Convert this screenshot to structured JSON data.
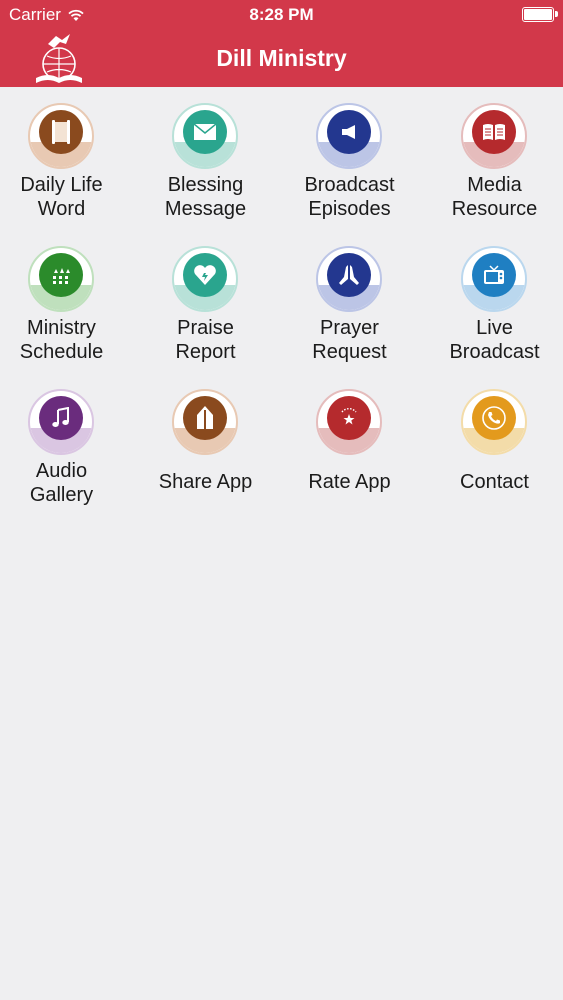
{
  "status_bar": {
    "carrier": "Carrier",
    "time": "8:28 PM"
  },
  "nav": {
    "title": "Dill Ministry"
  },
  "tiles": [
    {
      "line1": "Daily Life",
      "line2": "Word",
      "icon": "scroll-icon",
      "color": "#8a4a1e",
      "ring": "#e8c9b3"
    },
    {
      "line1": "Blessing",
      "line2": "Message",
      "icon": "envelope-icon",
      "color": "#2aa58e",
      "ring": "#b8e1d8"
    },
    {
      "line1": "Broadcast",
      "line2": "Episodes",
      "icon": "megaphone-icon",
      "color": "#23378f",
      "ring": "#bcc5e6"
    },
    {
      "line1": "Media",
      "line2": "Resource",
      "icon": "book-icon",
      "color": "#b52a2d",
      "ring": "#e5bcbc"
    },
    {
      "line1": "Ministry",
      "line2": "Schedule",
      "icon": "church-calendar-icon",
      "color": "#2b8b2b",
      "ring": "#bfe0bd"
    },
    {
      "line1": "Praise",
      "line2": "Report",
      "icon": "heart-icon",
      "color": "#2aa58e",
      "ring": "#b8e1d8"
    },
    {
      "line1": "Prayer",
      "line2": "Request",
      "icon": "praying-hands-icon",
      "color": "#23378f",
      "ring": "#bcc5e6"
    },
    {
      "line1": "Live",
      "line2": "Broadcast",
      "icon": "tv-icon",
      "color": "#1f7fc2",
      "ring": "#bad7ee"
    },
    {
      "line1": "Audio",
      "line2": "Gallery",
      "icon": "music-note-icon",
      "color": "#6a2c7d",
      "ring": "#dac6e2"
    },
    {
      "line1": "Share App",
      "line2": "",
      "icon": "share-arrow-icon",
      "color": "#8a4a1e",
      "ring": "#e8c9b3"
    },
    {
      "line1": "Rate App",
      "line2": "",
      "icon": "star-icon",
      "color": "#b52a2d",
      "ring": "#e5bcbc"
    },
    {
      "line1": "Contact",
      "line2": "",
      "icon": "phone-icon",
      "color": "#e39a1d",
      "ring": "#f3dca9"
    }
  ]
}
